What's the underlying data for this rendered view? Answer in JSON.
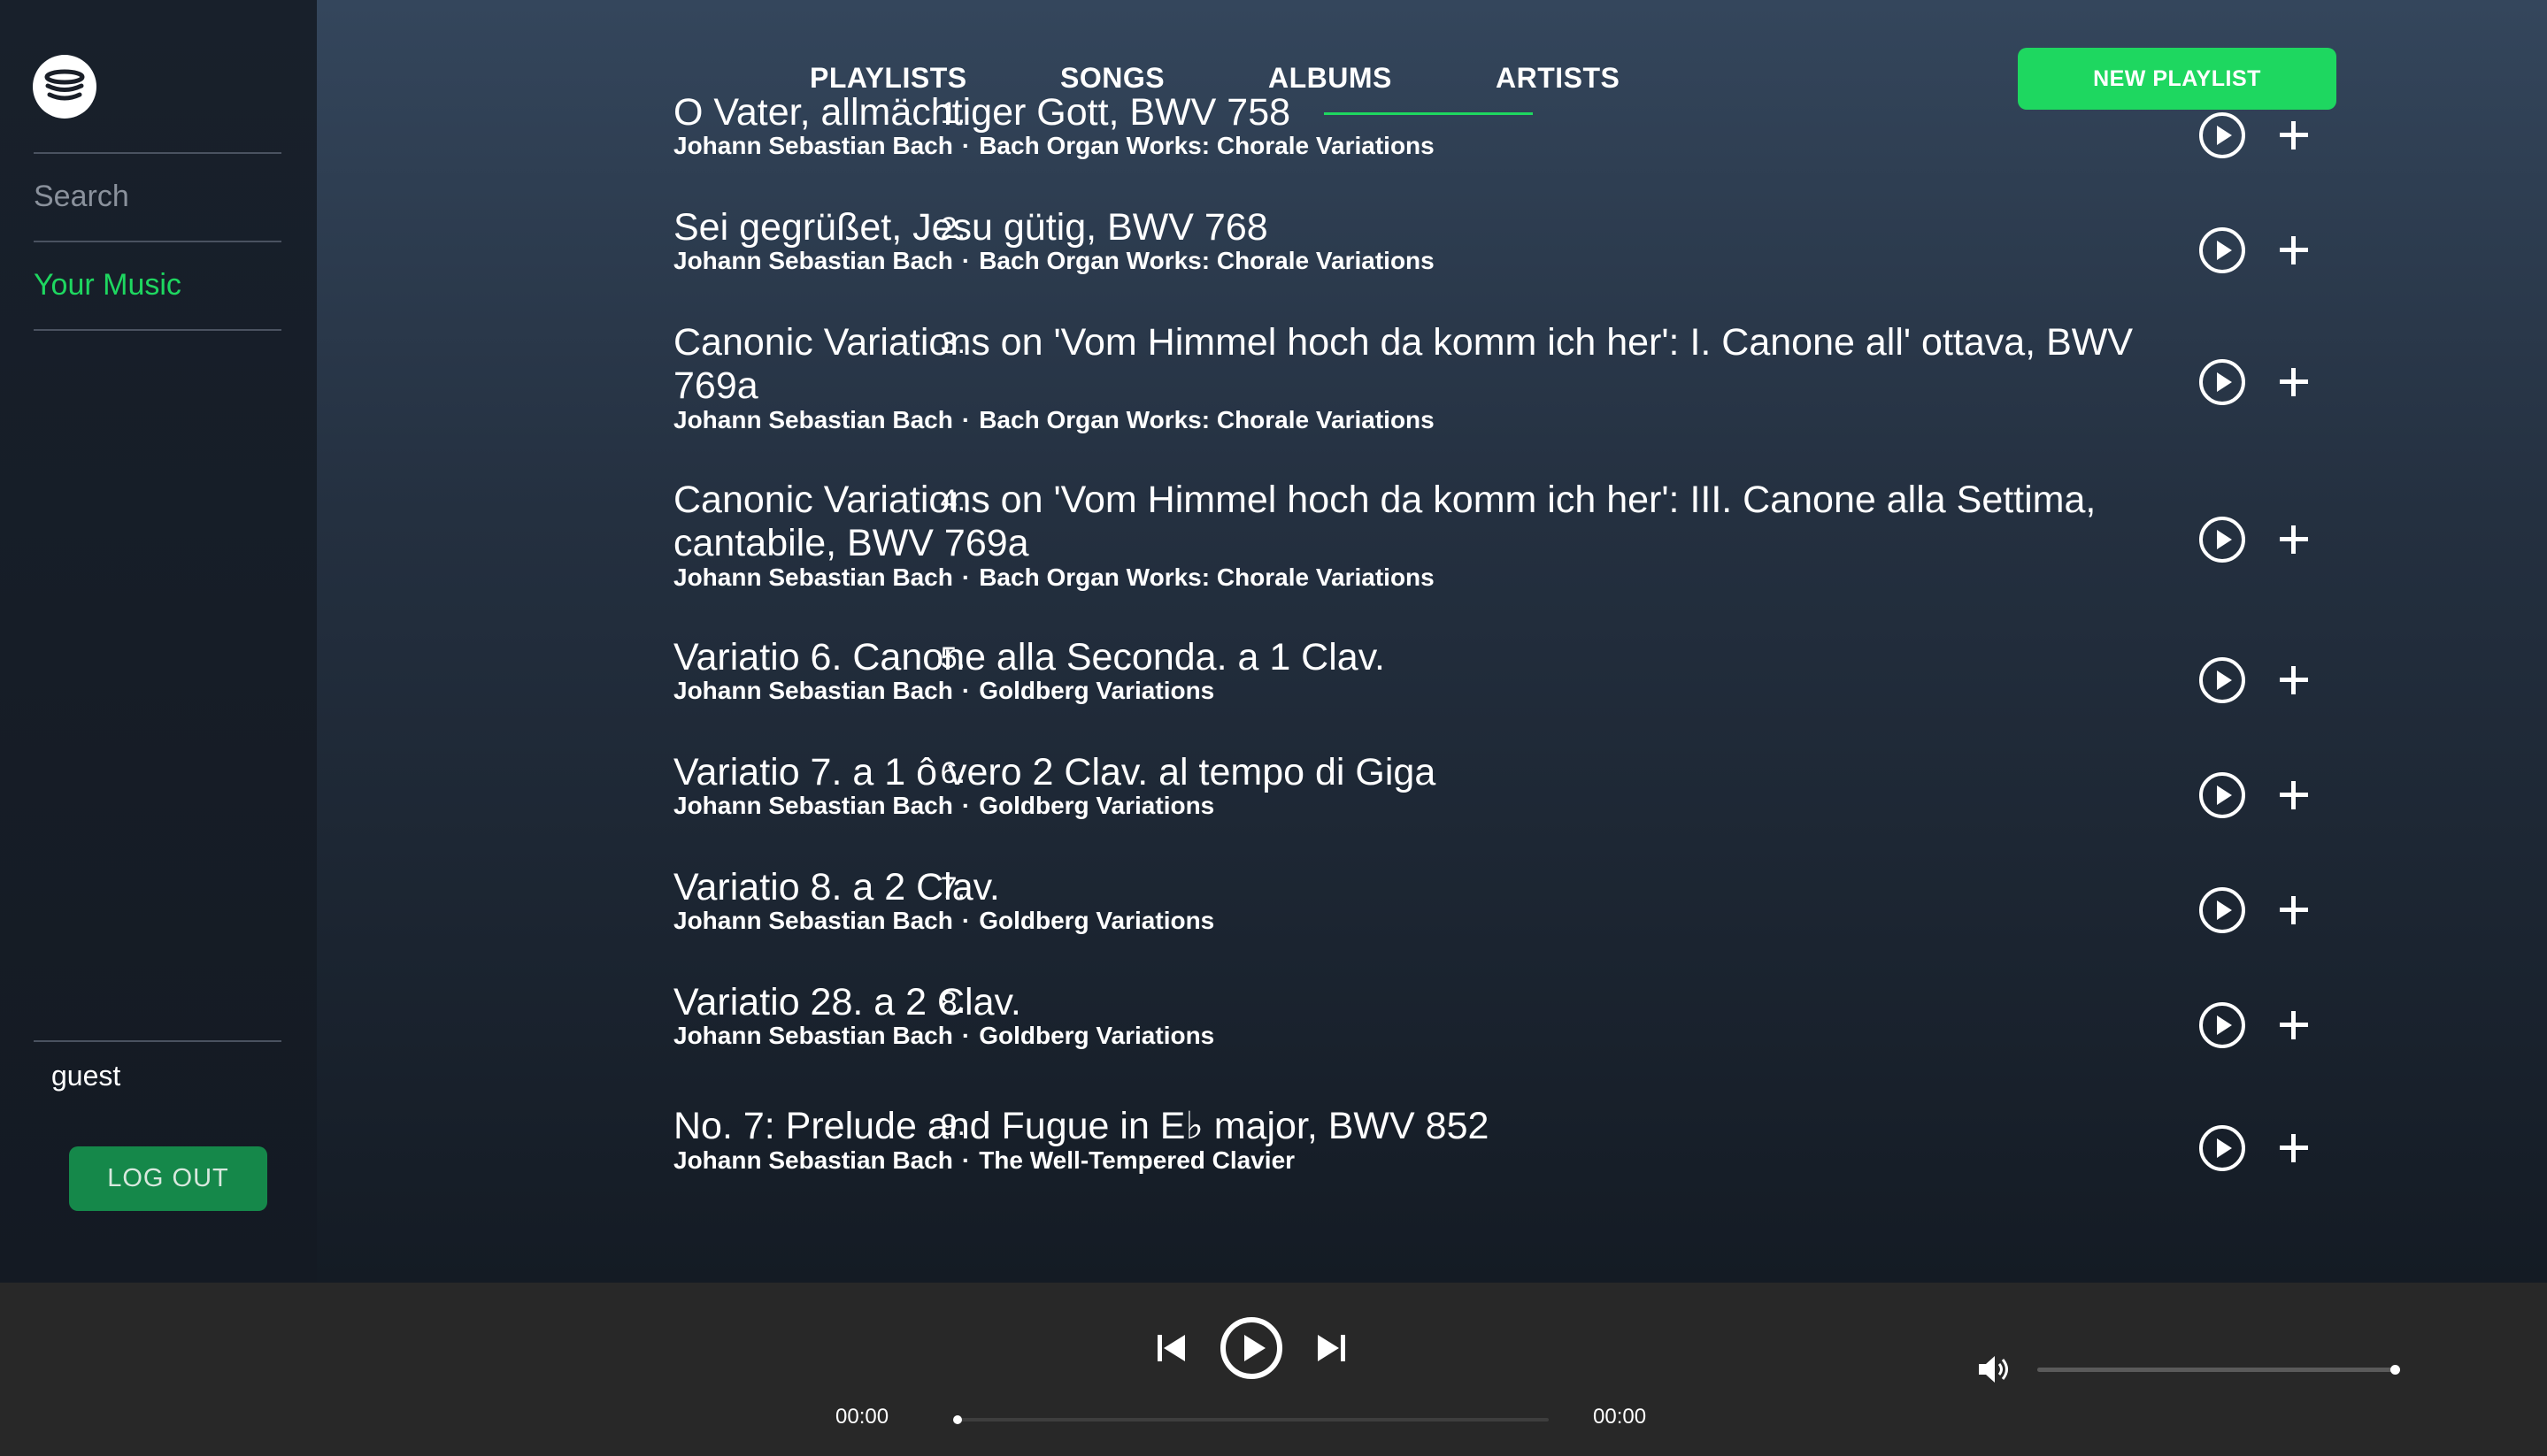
{
  "sidebar": {
    "logo_icon": "spotify-logo-icon",
    "nav": {
      "search_label": "Search",
      "your_music_label": "Your Music"
    },
    "username": "guest",
    "logout_label": "LOG OUT"
  },
  "tabs": [
    {
      "label": "PLAYLISTS",
      "active": false
    },
    {
      "label": "SONGS",
      "active": true
    },
    {
      "label": "ALBUMS",
      "active": false
    },
    {
      "label": "ARTISTS",
      "active": false
    }
  ],
  "new_playlist_label": "NEW PLAYLIST",
  "songs": [
    {
      "number": "1.",
      "title": "O Vater, allmächtiger Gott, BWV 758",
      "artist": "Johann Sebastian Bach",
      "separator": "·",
      "album": "Bach Organ Works: Chorale Variations"
    },
    {
      "number": "2.",
      "title": "Sei gegrüßet, Jesu gütig, BWV 768",
      "artist": "Johann Sebastian Bach",
      "separator": "·",
      "album": "Bach Organ Works: Chorale Variations"
    },
    {
      "number": "3.",
      "title": "Canonic Variations on 'Vom Himmel hoch da komm ich her': I. Canone all' ottava, BWV 769a",
      "artist": "Johann Sebastian Bach",
      "separator": "·",
      "album": "Bach Organ Works: Chorale Variations"
    },
    {
      "number": "4.",
      "title": "Canonic Variations on 'Vom Himmel hoch da komm ich her': III. Canone alla Settima, cantabile, BWV 769a",
      "artist": "Johann Sebastian Bach",
      "separator": "·",
      "album": "Bach Organ Works: Chorale Variations"
    },
    {
      "number": "5.",
      "title": "Variatio 6. Canone alla Seconda. a 1 Clav.",
      "artist": "Johann Sebastian Bach",
      "separator": "·",
      "album": "Goldberg Variations"
    },
    {
      "number": "6.",
      "title": "Variatio 7. a 1 ô vero 2 Clav. al tempo di Giga",
      "artist": "Johann Sebastian Bach",
      "separator": "·",
      "album": "Goldberg Variations"
    },
    {
      "number": "7.",
      "title": "Variatio 8. a 2 Clav.",
      "artist": "Johann Sebastian Bach",
      "separator": "·",
      "album": "Goldberg Variations"
    },
    {
      "number": "8.",
      "title": "Variatio 28. a 2 Clav.",
      "artist": "Johann Sebastian Bach",
      "separator": "·",
      "album": "Goldberg Variations"
    },
    {
      "number": "9.",
      "title": "No. 7: Prelude and Fugue in E♭ major, BWV 852",
      "artist": "Johann Sebastian Bach",
      "separator": "·",
      "album": "The Well-Tempered Clavier"
    }
  ],
  "player": {
    "current_time": "00:00",
    "total_time": "00:00",
    "progress": 0.0,
    "volume": 1.0,
    "icons": [
      "skip-previous-icon",
      "play-circle-icon",
      "skip-next-icon",
      "volume-icon"
    ]
  },
  "colors": {
    "accent": "#1ed760",
    "logout_button": "#15884a",
    "player_bg": "#282828"
  }
}
